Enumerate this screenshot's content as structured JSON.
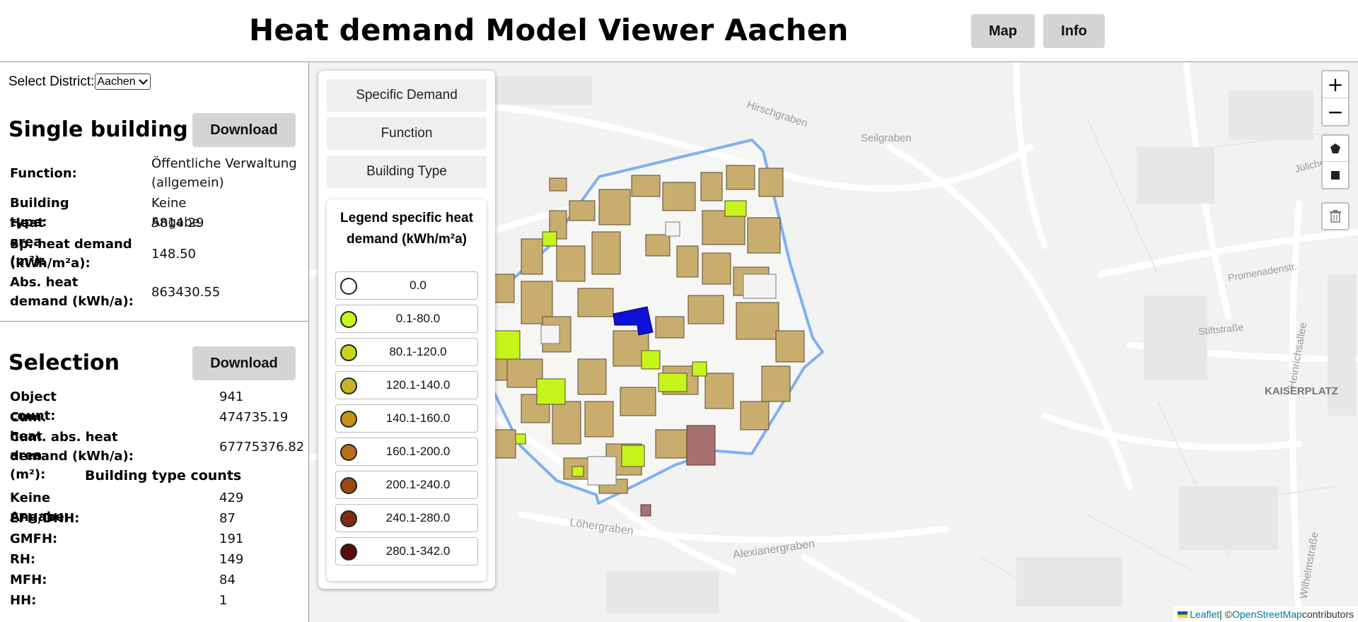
{
  "header": {
    "title": "Heat demand Model Viewer Aachen",
    "nav": {
      "map": "Map",
      "info": "Info"
    }
  },
  "sidebar": {
    "district_label": "Select District:",
    "district_value": "Aachen",
    "single": {
      "title": "Single building",
      "download": "Download",
      "rows": [
        {
          "k": "Function:",
          "v": "Öffentliche Verwaltung (allgemein)"
        },
        {
          "k": "Building type:",
          "v": "Keine Angabe"
        },
        {
          "k": "Heat area (m²):",
          "v": "5814.29"
        },
        {
          "k": "Sp. heat demand (kWh/m²a):",
          "v": "148.50"
        },
        {
          "k": "Abs. heat demand (kWh/a):",
          "v": "863430.55"
        }
      ]
    },
    "selection": {
      "title": "Selection",
      "download": "Download",
      "rows": [
        {
          "k": "Object count:",
          "v": "941"
        },
        {
          "k": "Cum. heat area (m²):",
          "v": "474735.19"
        },
        {
          "k": "Cum. abs. heat demand (kWh/a):",
          "v": "67775376.82"
        }
      ],
      "counts_title": "Building type counts",
      "counts": [
        {
          "k": "Keine Angabe:",
          "v": "429"
        },
        {
          "k": "EFH/DHH:",
          "v": "87"
        },
        {
          "k": "GMFH:",
          "v": "191"
        },
        {
          "k": "RH:",
          "v": "149"
        },
        {
          "k": "MFH:",
          "v": "84"
        },
        {
          "k": "HH:",
          "v": "1"
        }
      ]
    }
  },
  "layers": {
    "buttons": [
      "Specific Demand",
      "Function",
      "Building Type"
    ],
    "legend_title": "Legend specific heat demand (kWh/m²a)",
    "legend": [
      {
        "label": "0.0",
        "color": "#ffffff"
      },
      {
        "label": "0.1-80.0",
        "color": "#c6f51c"
      },
      {
        "label": "80.1-120.0",
        "color": "#c8d41a"
      },
      {
        "label": "120.1-140.0",
        "color": "#c8b42a"
      },
      {
        "label": "140.1-160.0",
        "color": "#c8921a"
      },
      {
        "label": "160.1-200.0",
        "color": "#b8701a"
      },
      {
        "label": "200.1-240.0",
        "color": "#9a4a12"
      },
      {
        "label": "240.1-280.0",
        "color": "#7f2a12"
      },
      {
        "label": "280.1-342.0",
        "color": "#5a0a0a"
      }
    ]
  },
  "map": {
    "street_labels": [
      "Hirschgraben",
      "Seilgraben",
      "Löhergraben",
      "Alexianergraben",
      "KAISERPLATZ",
      "Heinrichsallee",
      "Wilhelmstraße",
      "Promenadenstr.",
      "Stiftstraße",
      "Jülicher Str."
    ],
    "selection_color": "#7fb0f0",
    "building_color": "#c8ad6e",
    "selected_building_color": "#1010d8"
  },
  "controls": {
    "zoom_in": "+",
    "zoom_out": "−",
    "icons": [
      "polygon-icon",
      "rectangle-icon",
      "trash-icon"
    ]
  },
  "attribution": {
    "leaflet": "Leaflet",
    "sep": " | © ",
    "osm": "OpenStreetMap",
    "tail": " contributors"
  }
}
